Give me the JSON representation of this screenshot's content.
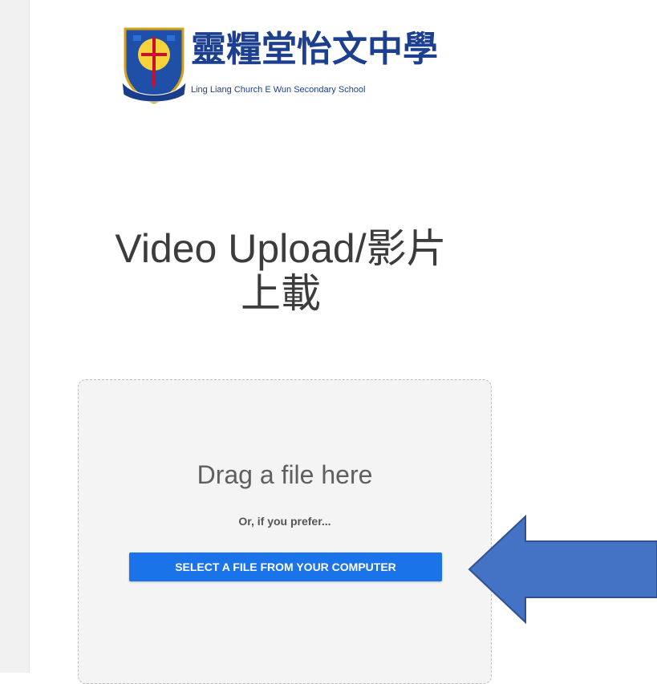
{
  "logo": {
    "name_zh": "靈糧堂怡文中學",
    "name_en": "Ling Liang Church E Wun Secondary School",
    "brand_color": "#1c3f8f"
  },
  "page": {
    "title_line1": "Video Upload/影片",
    "title_line2": "上載"
  },
  "dropzone": {
    "drag_text": "Drag a file here",
    "or_text": "Or, if you prefer...",
    "select_button_label": "SELECT A FILE FROM YOUR COMPUTER",
    "button_color": "#1a73e8"
  },
  "annotation": {
    "arrow_icon": "arrow-left-icon",
    "arrow_color": "#4472c4"
  }
}
